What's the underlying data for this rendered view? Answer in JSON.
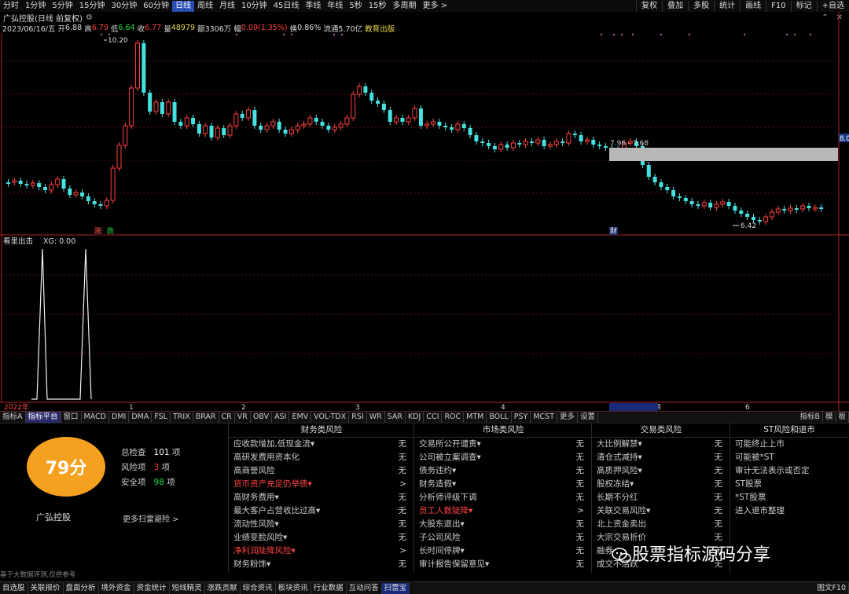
{
  "toolbar": {
    "timeframes": [
      "分时",
      "1分钟",
      "5分钟",
      "15分钟",
      "30分钟",
      "60分钟",
      "日线",
      "周线",
      "月线",
      "10分钟",
      "45日线",
      "季线",
      "年线",
      "5秒",
      "15秒",
      "多周期",
      "更多 >"
    ],
    "active_index": 6,
    "right_buttons": [
      "复权",
      "叠加",
      "多股",
      "统计",
      "画线",
      "F10",
      "标记",
      "+自选"
    ]
  },
  "titlebar": {
    "name": "广弘控股(日线 前复权)"
  },
  "info": {
    "date": "2023/06/16/五",
    "open_label": "开",
    "open": "6.88",
    "high_label": "高",
    "high": "6.79",
    "low_label": "低",
    "low": "6.64",
    "close_label": "收",
    "close": "6.77",
    "vol_label": "量",
    "vol": "48979",
    "amt_label": "额",
    "amt": "3306万",
    "chg_label": "幅",
    "chg": "0.09(1.35%)",
    "turn_label": "换",
    "turn": "0.86%",
    "float_label": "流通",
    "float": "5.70亿",
    "tag": "教育出版"
  },
  "price_labels": {
    "high": "10.20",
    "low": "6.42",
    "range": "7.96 - 7.68",
    "right_tag": "8.0"
  },
  "markers": {
    "zhang": "涨",
    "die": "跌",
    "cai": "财"
  },
  "indicator": {
    "name": "看里出击",
    "value": "XG: 0.00"
  },
  "axis": {
    "x_labels": [
      "2022年",
      "1",
      "2",
      "3",
      "4",
      "2023/04/27/四",
      "6"
    ]
  },
  "indicator_tabs": [
    "指标A",
    "指标平台",
    "窗口",
    "MACD",
    "DMI",
    "DMA",
    "FSL",
    "TRIX",
    "BRAR",
    "CR",
    "VR",
    "OBV",
    "ASI",
    "EMV",
    "VOL-TDX",
    "RSI",
    "WR",
    "SAR",
    "KDJ",
    "CCI",
    "ROC",
    "MTM",
    "BOLL",
    "PSY",
    "MCST",
    "更多",
    "设置"
  ],
  "indicator_tabs_right": [
    "指标B",
    "模",
    "板"
  ],
  "risk": {
    "score": "79分",
    "total_label": "总检查",
    "total": "101",
    "total_unit": "项",
    "risk_label": "风险项",
    "risk": "3",
    "risk_unit": "项",
    "safe_label": "安全项",
    "safe": "98",
    "safe_unit": "项",
    "company": "广弘控股",
    "more": "更多扫雷避险 >",
    "disclaimer": "基于大数据评测,仅供参考"
  },
  "columns": [
    {
      "title": "财务类风险",
      "rows": [
        [
          "应收款增加,低现金流▾",
          "无"
        ],
        [
          "高研发费用资本化",
          "无"
        ],
        [
          "高商誉风险",
          "无"
        ],
        [
          "货币资产充足仍举债▾",
          ">"
        ],
        [
          "高财务费用▾",
          "无"
        ],
        [
          "最大客户占营收比过高▾",
          "无"
        ],
        [
          "流动性风险▾",
          "无"
        ],
        [
          "业绩变脸风险▾",
          "无"
        ],
        [
          "净利润陡降风险▾",
          ">"
        ],
        [
          "财务粉饰▾",
          "无"
        ]
      ],
      "red": [
        3,
        8
      ]
    },
    {
      "title": "市场类风险",
      "rows": [
        [
          "交易所公开谴责▾",
          "无"
        ],
        [
          "公司被立案调查▾",
          "无"
        ],
        [
          "债务违约▾",
          "无"
        ],
        [
          "财务造假▾",
          "无"
        ],
        [
          "分析师评级下调",
          "无"
        ],
        [
          "员工人数陡降▾",
          ">"
        ],
        [
          "大股东退出▾",
          "无"
        ],
        [
          "子公司风险",
          "无"
        ],
        [
          "长时间停牌▾",
          "无"
        ],
        [
          "审计报告保留意见▾",
          "无"
        ]
      ],
      "red": [
        5
      ]
    },
    {
      "title": "交易类风险",
      "rows": [
        [
          "大比例解禁▾",
          "无"
        ],
        [
          "清仓式减持▾",
          "无"
        ],
        [
          "高质押风险▾",
          "无"
        ],
        [
          "股权冻结▾",
          "无"
        ],
        [
          "长期不分红",
          "无"
        ],
        [
          "关联交易风险▾",
          "无"
        ],
        [
          "北上资金卖出",
          "无"
        ],
        [
          "大宗交易折价",
          "无"
        ],
        [
          "融券",
          "无"
        ],
        [
          "成交不活跃",
          "无"
        ]
      ],
      "red": []
    },
    {
      "title": "ST风险和退市",
      "rows": [
        [
          "可能终止上市",
          ""
        ],
        [
          "可能被*ST",
          ""
        ],
        [
          "审计无法表示或否定",
          ""
        ],
        [
          "ST股票",
          ""
        ],
        [
          "*ST股票",
          ""
        ],
        [
          "进入退市整理",
          ""
        ]
      ],
      "red": []
    }
  ],
  "footer": [
    "自选股",
    "关联报价",
    "盘面分析",
    "境外资金",
    "资金统计",
    "短线精灵",
    "涨跌贡献",
    "综合资讯",
    "板块资讯",
    "行业数据",
    "互动问答",
    "扫雷宝"
  ],
  "footer_right": "图文F10",
  "watermark": "股票指标源码分享",
  "colors": {
    "up": "#ff4040",
    "down": "#45e0e0",
    "score_bg": "#f6a020",
    "axis": "#b02020"
  }
}
